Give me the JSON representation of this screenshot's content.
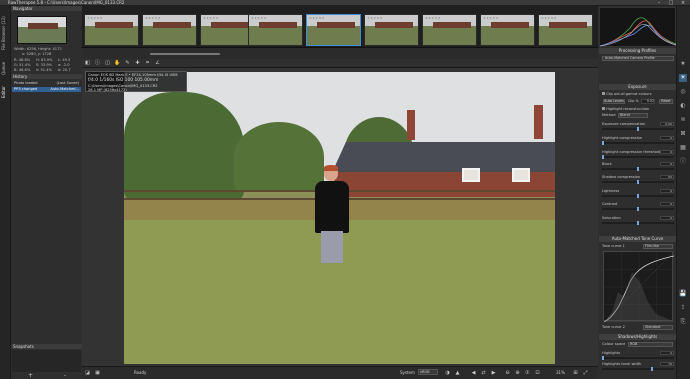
{
  "window": {
    "title": "RawTherapee 5.8 - C:\\Users\\Images\\Canon\\IMG_0133.CR2",
    "minimize_icon": "minimize-icon",
    "maximize_icon": "maximize-icon",
    "close_icon": "close-icon"
  },
  "left_tabs": {
    "file_browser": "File Browser (13)",
    "queue": "Queue",
    "editor": "Editor"
  },
  "navigator": {
    "title": "Navigator",
    "size": "Width: 6256, Height: 4172",
    "coords": "x: 5280, y: 1728",
    "r": "R: 48.8%",
    "g": "G: 51.4%",
    "b": "B: 48.6%",
    "h": "H: 83.9%",
    "s": "S: 33.9%",
    "v": "V: 51.4%",
    "l": "L: 49.5",
    "a": "a: -2.0",
    "bb": "b: 20.7"
  },
  "history": {
    "title": "History",
    "items": [
      {
        "label": "Photo loaded",
        "value": "(Last Saved)"
      },
      {
        "label": "PP3 changed",
        "value": "Auto-Matched..."
      }
    ]
  },
  "snapshots": {
    "title": "Snapshots",
    "add_label": "+",
    "remove_label": "-"
  },
  "filmstrip": {
    "thumb_count": 9,
    "selected_index": 4
  },
  "exif": {
    "camera": "Canon EOS 6D Mark II • EF24-105mm f/4L IS USM",
    "exposure": "f/4.0  1/160s  ISO 100  105.00mm",
    "path": "C:\\Users\\Images\\Canon\\IMG_0133.CR2",
    "dims": "26.1 MP (6256x4172)"
  },
  "status": {
    "ready": "Ready",
    "system_label": "System",
    "system_value": "sRGB",
    "zoom": "31%"
  },
  "right_panel": {
    "processing_profiles_title": "Processing Profiles",
    "profile_value": "Auto-Matched Camera Profile",
    "exposure_title": "Exposure",
    "clip_label": "Clip out-of-gamut colours",
    "auto_levels": "Auto Levels",
    "clip_percent": "Clip %",
    "clip_value": "0.02",
    "reset": "Reset",
    "highlight_reconstruction": "Highlight reconstruction",
    "method_label": "Method",
    "method_value": "Blend",
    "sliders": [
      {
        "label": "Exposure compensation",
        "value": "0.00",
        "pos": 0.5
      },
      {
        "label": "Highlight compression",
        "value": "0",
        "pos": 0.0
      },
      {
        "label": "Highlight compression threshold",
        "value": "0",
        "pos": 0.0
      },
      {
        "label": "Black",
        "value": "0",
        "pos": 0.5
      },
      {
        "label": "Shadow compression",
        "value": "50",
        "pos": 0.5
      },
      {
        "label": "Lightness",
        "value": "0",
        "pos": 0.5
      },
      {
        "label": "Contrast",
        "value": "0",
        "pos": 0.5
      },
      {
        "label": "Saturation",
        "value": "0",
        "pos": 0.5
      }
    ],
    "tone_curve_title": "Auto-Matched Tone Curve",
    "tone_curve_1": "Tone curve 1",
    "tone_curve_1_mode": "Film-like",
    "tone_curve_2": "Tone curve 2",
    "tone_curve_2_mode": "Standard",
    "shadows_title": "Shadows/Highlights",
    "colour_space_label": "Colour space",
    "colour_space_value": "RGB",
    "highlights_label": "Highlights",
    "highlights_value": "0",
    "tonal_width_label": "Highlights tonal width",
    "tonal_width_value": "70"
  },
  "colors": {
    "accent": "#3a8fd6",
    "bg": "#2b2b2b",
    "selected_row": "#2f5f93"
  }
}
